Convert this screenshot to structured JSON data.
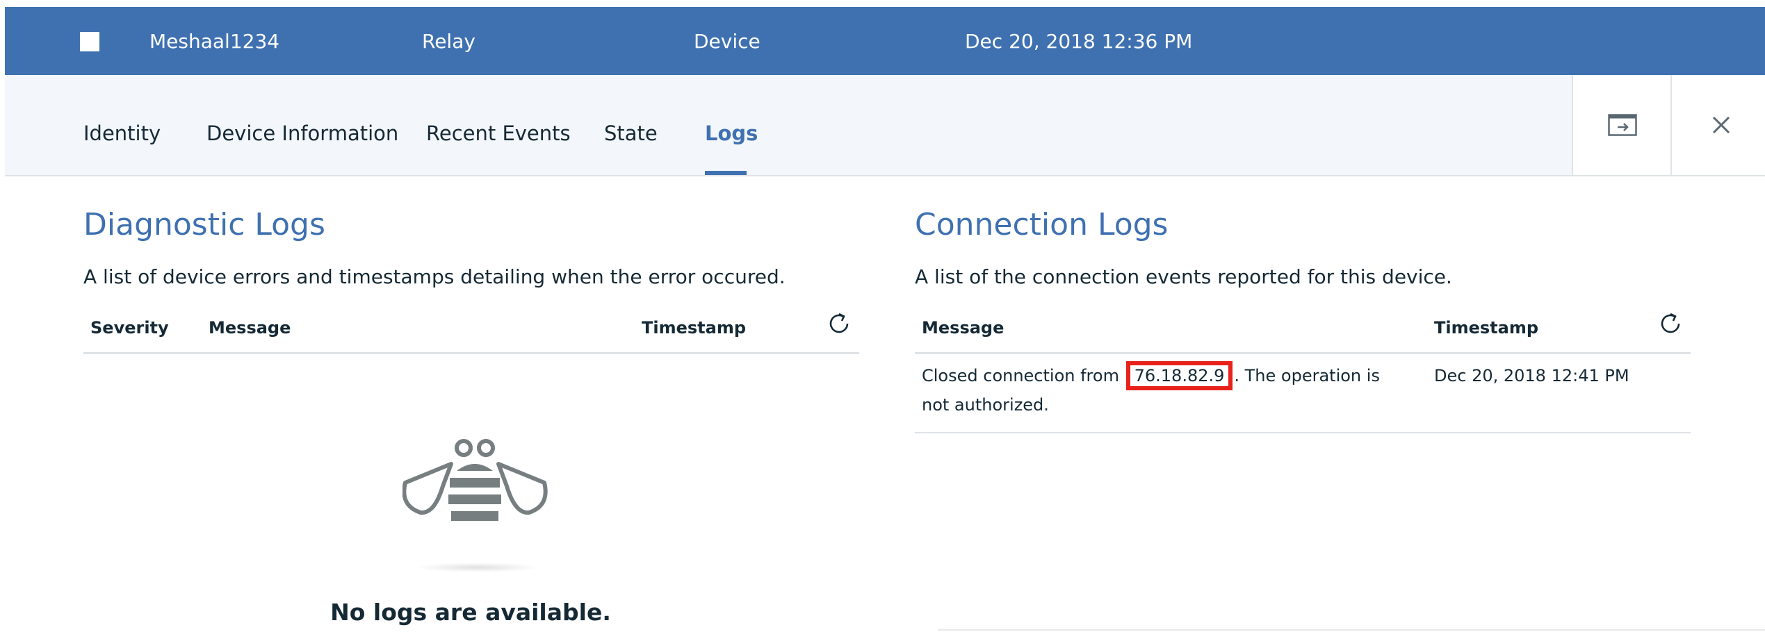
{
  "header": {
    "device_id": "Meshaal1234",
    "device_type": "Relay",
    "class": "Device",
    "date_added": "Dec 20, 2018 12:36 PM"
  },
  "tabs": [
    {
      "label": "Identity"
    },
    {
      "label": "Device Information"
    },
    {
      "label": "Recent Events"
    },
    {
      "label": "State"
    },
    {
      "label": "Logs",
      "active": true
    }
  ],
  "toolbar": {
    "expand_icon": "panel-expand-icon",
    "close_icon": "close-icon"
  },
  "diagnostic": {
    "title": "Diagnostic Logs",
    "description": "A list of device errors and timestamps detailing when the error occured.",
    "columns": [
      "Severity",
      "Message",
      "Timestamp"
    ],
    "empty_icon": "bee-icon",
    "empty_text": "No logs are available."
  },
  "connection": {
    "title": "Connection Logs",
    "description": "A list of the connection events reported for this device.",
    "columns": [
      "Message",
      "Timestamp"
    ],
    "rows": [
      {
        "message_before": "Closed connection from",
        "message_highlight": "76.18.82.9",
        "message_after": ". The operation is not authorized.",
        "timestamp": "Dec 20, 2018 12:41 PM"
      }
    ]
  },
  "colors": {
    "accent": "#3f71b1",
    "highlight": "#e8221b"
  }
}
